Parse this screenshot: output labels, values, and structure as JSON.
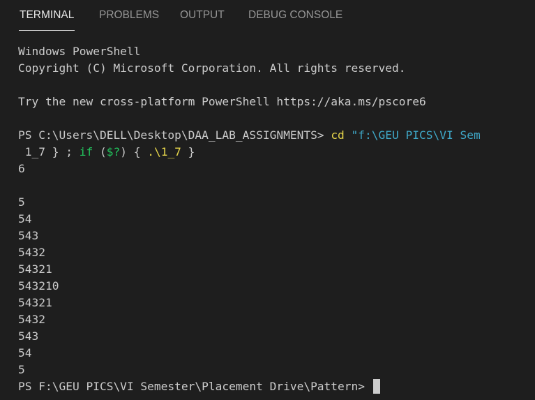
{
  "tabs": [
    {
      "label": "TERMINAL",
      "active": true
    },
    {
      "label": "PROBLEMS",
      "active": false
    },
    {
      "label": "OUTPUT",
      "active": false
    },
    {
      "label": "DEBUG CONSOLE",
      "active": false
    }
  ],
  "terminal": {
    "banner_line1": "Windows PowerShell",
    "banner_line2": "Copyright (C) Microsoft Corporation. All rights reserved.",
    "tip_line": "Try the new cross-platform PowerShell https://aka.ms/pscore6",
    "command": {
      "prompt": "PS C:\\Users\\DELL\\Desktop\\DAA_LAB_ASSIGNMENTS> ",
      "cd": "cd",
      "path_arg": " \"f:\\GEU PICS\\VI Sem",
      "cont_prefix": " 1_7 } ; ",
      "if_kw": "if",
      "cond_open": " (",
      "cond_var": "$?",
      "cond_close": ") { ",
      "exe": ".\\1_7",
      "close": " }"
    },
    "input_value": "6",
    "output_lines": [
      "5",
      "54",
      "543",
      "5432",
      "54321",
      "543210",
      "54321",
      "5432",
      "543",
      "54",
      "5"
    ],
    "final_prompt": "PS F:\\GEU PICS\\VI Semester\\Placement Drive\\Pattern> "
  }
}
